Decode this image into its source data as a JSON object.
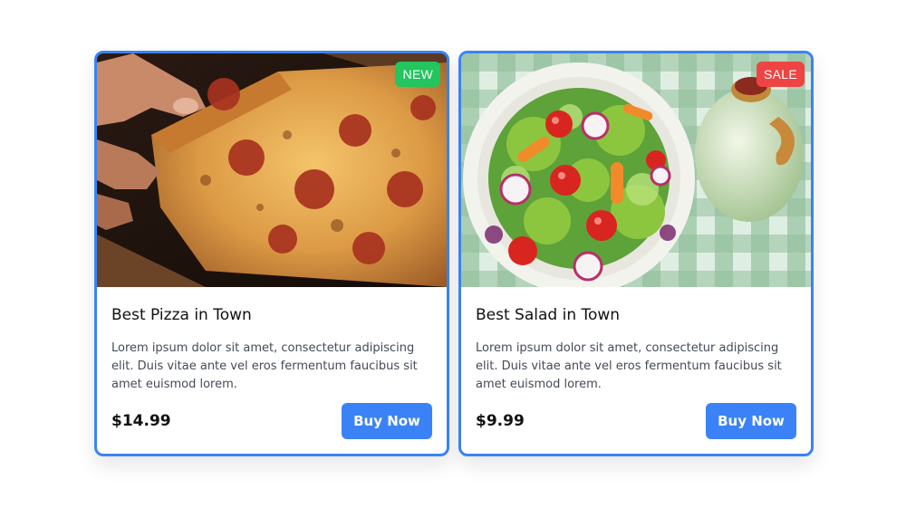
{
  "cards": [
    {
      "image_alt": "Pizza slice being lifted by a hand",
      "badge": "NEW",
      "title": "Best Pizza in Town",
      "description": "Lorem ipsum dolor sit amet, consectetur adipiscing elit. Duis vitae ante vel eros fermentum faucibus sit amet euismod lorem.",
      "price": "$14.99",
      "button_label": "Buy Now"
    },
    {
      "image_alt": "Bowl of fresh salad on a checkered tablecloth",
      "badge": "SALE",
      "title": "Best Salad in Town",
      "description": "Lorem ipsum dolor sit amet, consectetur adipiscing elit. Duis vitae ante vel eros fermentum faucibus sit amet euismod lorem.",
      "price": "$9.99",
      "button_label": "Buy Now"
    }
  ],
  "colors": {
    "accent": "#3b82f6",
    "badge_new": "#22c55e",
    "badge_sale": "#ef4444"
  }
}
